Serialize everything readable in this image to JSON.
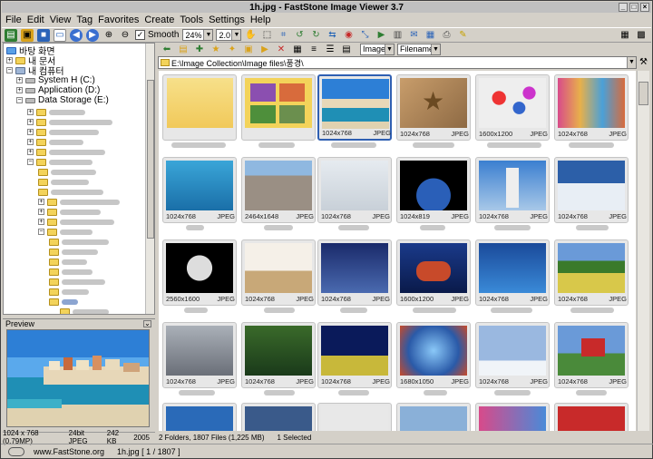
{
  "window": {
    "title": "1h.jpg  -  FastStone Image Viewer 3.7"
  },
  "menu": [
    "File",
    "Edit",
    "View",
    "Tag",
    "Favorites",
    "Create",
    "Tools",
    "Settings",
    "Help"
  ],
  "toolbar": {
    "smooth_label": "Smooth",
    "zoom": "24%",
    "gamma": "2.0"
  },
  "tree": {
    "desktop": "바탕 화면",
    "mydocs": "내 문서",
    "mycomputer": "내 컴퓨터",
    "drive_c": "System H (C:)",
    "drive_d": "Application (D:)",
    "drive_e": "Data Storage (E:)"
  },
  "filter": {
    "type": "Images",
    "sort": "Filename"
  },
  "address": "E:\\Image Collection\\Image files\\풍경\\",
  "thumbs": [
    {
      "res": "",
      "fmt": ""
    },
    {
      "res": "",
      "fmt": ""
    },
    {
      "res": "1024x768",
      "fmt": "JPEG"
    },
    {
      "res": "1024x768",
      "fmt": "JPEG"
    },
    {
      "res": "1600x1200",
      "fmt": "JPEG"
    },
    {
      "res": "1024x768",
      "fmt": "JPEG"
    },
    {
      "res": "1024x768",
      "fmt": "JPEG"
    },
    {
      "res": "2464x1648",
      "fmt": "JPEG"
    },
    {
      "res": "1024x768",
      "fmt": "JPEG"
    },
    {
      "res": "1024x819",
      "fmt": "JPEG"
    },
    {
      "res": "1024x768",
      "fmt": "JPEG"
    },
    {
      "res": "1024x768",
      "fmt": "JPEG"
    },
    {
      "res": "2560x1600",
      "fmt": "JPEG"
    },
    {
      "res": "1024x768",
      "fmt": "JPEG"
    },
    {
      "res": "1024x768",
      "fmt": "JPEG"
    },
    {
      "res": "1600x1200",
      "fmt": "JPEG"
    },
    {
      "res": "1024x768",
      "fmt": "JPEG"
    },
    {
      "res": "1024x768",
      "fmt": "JPEG"
    },
    {
      "res": "1024x768",
      "fmt": "JPEG"
    },
    {
      "res": "1024x768",
      "fmt": "JPEG"
    },
    {
      "res": "1024x768",
      "fmt": "JPEG"
    },
    {
      "res": "1680x1050",
      "fmt": "JPEG"
    },
    {
      "res": "1024x768",
      "fmt": "JPEG"
    },
    {
      "res": "1024x768",
      "fmt": "JPEG"
    }
  ],
  "preview": {
    "label": "Preview",
    "dims": "1024 x 768 (0.79MP)",
    "depth": "24bit JPEG",
    "size": "242 KB",
    "year": "2005"
  },
  "status": {
    "folders_files": "2 Folders, 1807 Files (1,225 MB)",
    "selected": "1 Selected"
  },
  "bottom": {
    "site": "www.FastStone.org",
    "file": "1h.jpg [ 1 / 1807 ]"
  }
}
